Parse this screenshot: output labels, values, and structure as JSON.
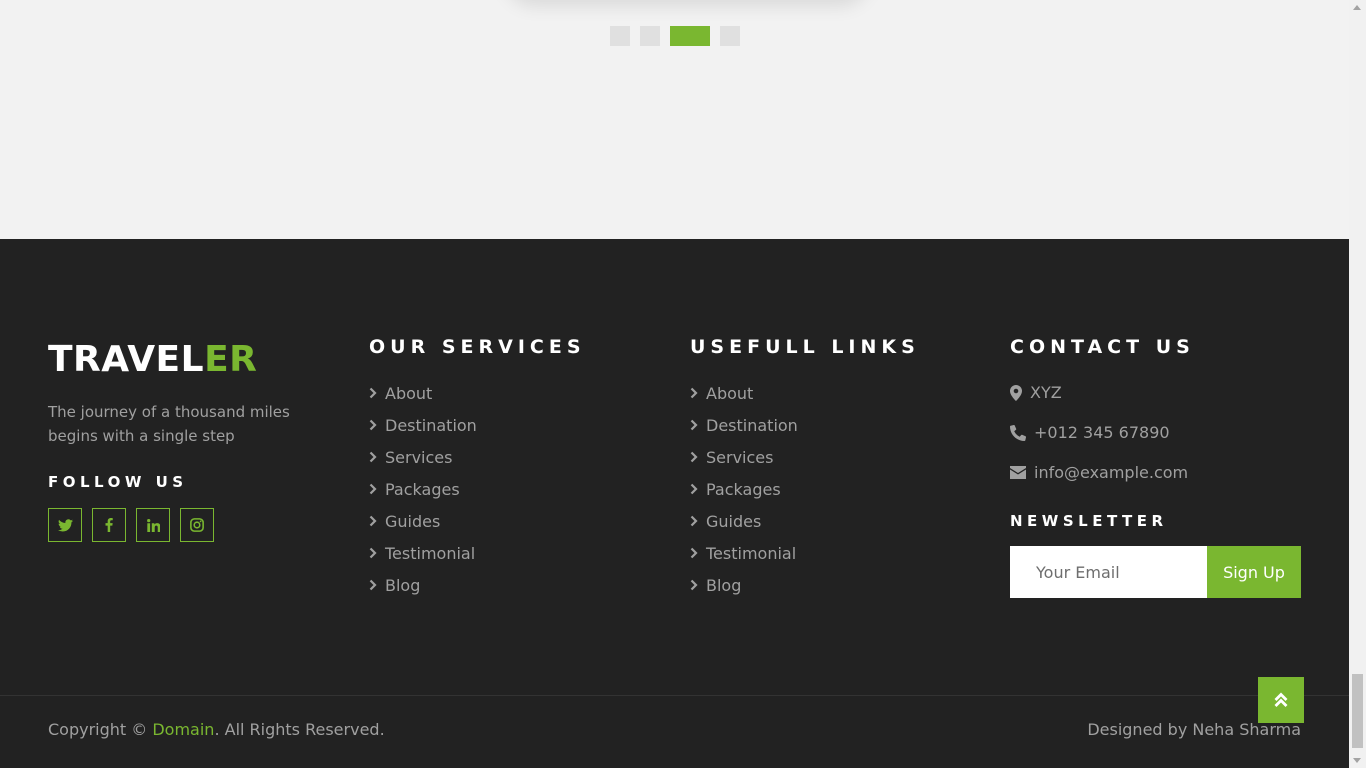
{
  "colors": {
    "accent": "#7ab730",
    "footer_bg": "#222222",
    "text_muted": "#a0a0a0",
    "page_bg": "#f2f2f2"
  },
  "carousel": {
    "active_index": 2,
    "dot_count": 4
  },
  "brand": {
    "main": "TRAVEL",
    "accent": "ER"
  },
  "tagline": "The journey of a thousand miles begins with a single step",
  "follow": {
    "title": "FOLLOW US",
    "icons": [
      "twitter-icon",
      "facebook-icon",
      "linkedin-icon",
      "instagram-icon"
    ]
  },
  "services": {
    "title": "OUR SERVICES",
    "items": [
      "About",
      "Destination",
      "Services",
      "Packages",
      "Guides",
      "Testimonial",
      "Blog"
    ]
  },
  "useful": {
    "title": "USEFULL LINKS",
    "items": [
      "About",
      "Destination",
      "Services",
      "Packages",
      "Guides",
      "Testimonial",
      "Blog"
    ]
  },
  "contact": {
    "title": "CONTACT US",
    "address": "XYZ",
    "phone": "+012 345 67890",
    "email": "info@example.com"
  },
  "newsletter": {
    "title": "NEWSLETTER",
    "placeholder": "Your Email",
    "button": "Sign Up"
  },
  "bottom": {
    "copyright_prefix": "Copyright © ",
    "copyright_link": "Domain",
    "copyright_suffix": ". All Rights Reserved.",
    "designed_by": "Designed by Neha Sharma"
  }
}
